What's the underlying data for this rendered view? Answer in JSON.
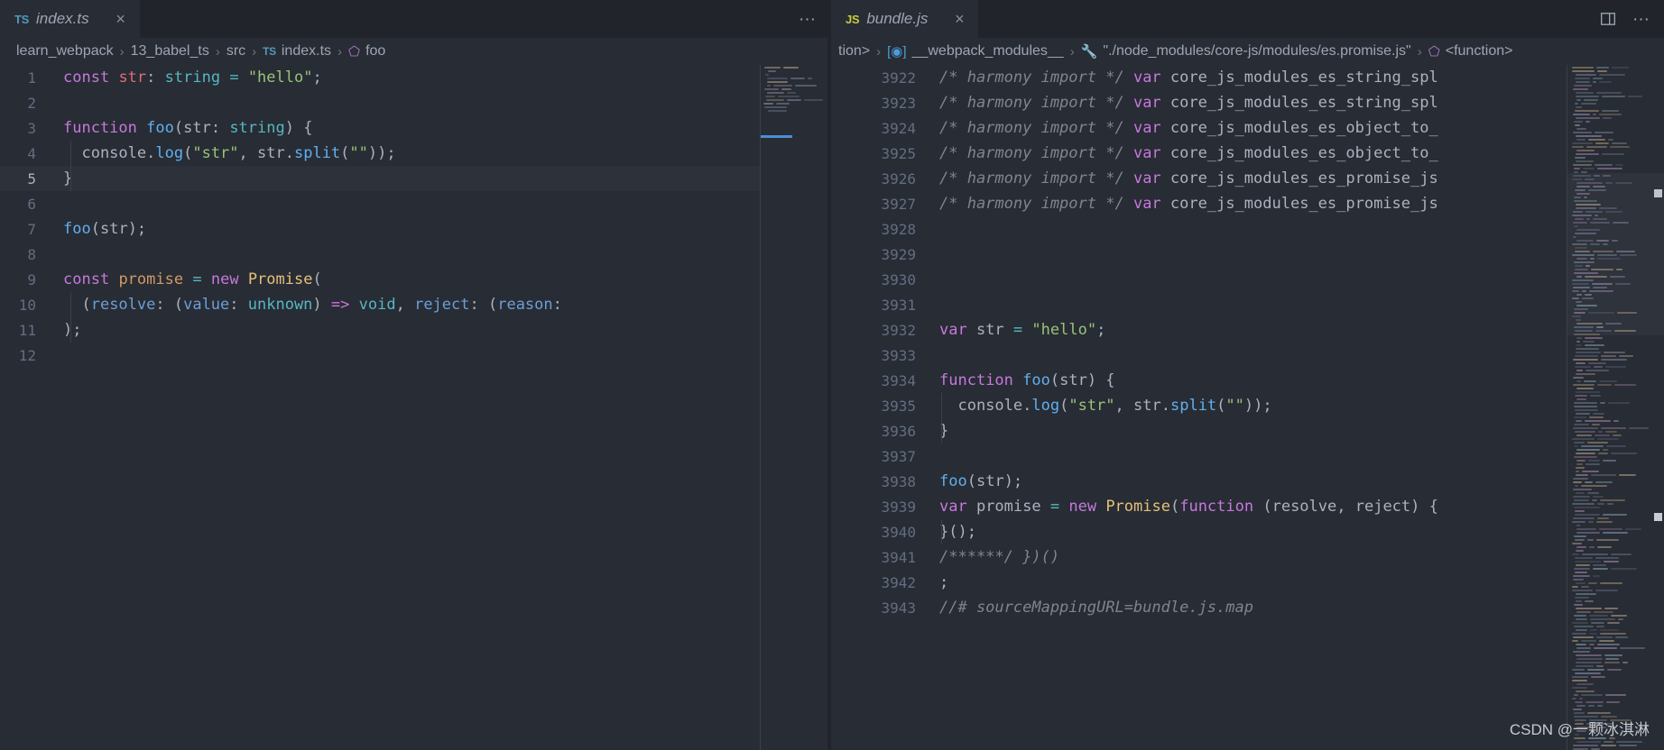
{
  "theme": {
    "editor_bg": "#282c34",
    "tabbar_bg": "#21252b",
    "active_line_bg": "#2c313a",
    "line_number": "#636d83",
    "foreground": "#abb2bf",
    "keyword": "#c678dd",
    "string": "#98c379",
    "function": "#61afef",
    "type": "#56b6c2",
    "variable": "#e06c75",
    "class": "#e5c07b",
    "number_orange": "#d19a66",
    "comment": "#7f848e",
    "accent_blue": "#4b8ed8"
  },
  "left_group": {
    "tab": {
      "icon": "ts-file-icon",
      "icon_label": "TS",
      "label": "index.ts",
      "close_label": "×"
    },
    "actions": [
      {
        "name": "more-actions",
        "glyph": "···"
      }
    ],
    "breadcrumb": [
      {
        "text": "learn_webpack",
        "icon": ""
      },
      {
        "text": "13_babel_ts",
        "icon": ""
      },
      {
        "text": "src",
        "icon": ""
      },
      {
        "text": "index.ts",
        "icon": "TS"
      },
      {
        "text": "foo",
        "icon": "symbol-function-icon"
      }
    ],
    "active_line": 5,
    "lines": [
      {
        "n": 1,
        "tokens": [
          {
            "t": "const",
            "c": "t-kw"
          },
          {
            "t": " ",
            "c": "t-plain"
          },
          {
            "t": "str",
            "c": "t-var"
          },
          {
            "t": ": ",
            "c": "t-punct"
          },
          {
            "t": "string",
            "c": "t-type"
          },
          {
            "t": " ",
            "c": "t-plain"
          },
          {
            "t": "=",
            "c": "t-op"
          },
          {
            "t": " ",
            "c": "t-plain"
          },
          {
            "t": "\"hello\"",
            "c": "t-str"
          },
          {
            "t": ";",
            "c": "t-punct"
          }
        ]
      },
      {
        "n": 2,
        "tokens": []
      },
      {
        "n": 3,
        "tokens": [
          {
            "t": "function",
            "c": "t-kw"
          },
          {
            "t": " ",
            "c": "t-plain"
          },
          {
            "t": "foo",
            "c": "t-fn"
          },
          {
            "t": "(",
            "c": "t-punct"
          },
          {
            "t": "str",
            "c": "t-arg"
          },
          {
            "t": ": ",
            "c": "t-punct"
          },
          {
            "t": "string",
            "c": "t-type"
          },
          {
            "t": ") {",
            "c": "t-punct"
          }
        ]
      },
      {
        "n": 4,
        "tokens": [
          {
            "t": "  console",
            "c": "t-plain"
          },
          {
            "t": ".",
            "c": "t-punct"
          },
          {
            "t": "log",
            "c": "t-fn"
          },
          {
            "t": "(",
            "c": "t-punct"
          },
          {
            "t": "\"str\"",
            "c": "t-str"
          },
          {
            "t": ", ",
            "c": "t-punct"
          },
          {
            "t": "str",
            "c": "t-plain"
          },
          {
            "t": ".",
            "c": "t-punct"
          },
          {
            "t": "split",
            "c": "t-fn"
          },
          {
            "t": "(",
            "c": "t-punct"
          },
          {
            "t": "\"\"",
            "c": "t-str"
          },
          {
            "t": "));",
            "c": "t-punct"
          }
        ]
      },
      {
        "n": 5,
        "tokens": [
          {
            "t": "}",
            "c": "t-punct"
          }
        ]
      },
      {
        "n": 6,
        "tokens": []
      },
      {
        "n": 7,
        "tokens": [
          {
            "t": "foo",
            "c": "t-fn"
          },
          {
            "t": "(",
            "c": "t-punct"
          },
          {
            "t": "str",
            "c": "t-arg"
          },
          {
            "t": ");",
            "c": "t-punct"
          }
        ]
      },
      {
        "n": 8,
        "tokens": []
      },
      {
        "n": 9,
        "tokens": [
          {
            "t": "const",
            "c": "t-kw"
          },
          {
            "t": " ",
            "c": "t-plain"
          },
          {
            "t": "promise",
            "c": "t-param"
          },
          {
            "t": " ",
            "c": "t-plain"
          },
          {
            "t": "=",
            "c": "t-op"
          },
          {
            "t": " ",
            "c": "t-plain"
          },
          {
            "t": "new",
            "c": "t-kw"
          },
          {
            "t": " ",
            "c": "t-plain"
          },
          {
            "t": "Promise",
            "c": "t-class"
          },
          {
            "t": "(",
            "c": "t-punct"
          }
        ]
      },
      {
        "n": 10,
        "tokens": [
          {
            "t": "  (",
            "c": "t-punct"
          },
          {
            "t": "resolve",
            "c": "t-paramblue"
          },
          {
            "t": ": (",
            "c": "t-punct"
          },
          {
            "t": "value",
            "c": "t-paramblue"
          },
          {
            "t": ": ",
            "c": "t-punct"
          },
          {
            "t": "unknown",
            "c": "t-type"
          },
          {
            "t": ") ",
            "c": "t-punct"
          },
          {
            "t": "=>",
            "c": "t-kw"
          },
          {
            "t": " ",
            "c": "t-plain"
          },
          {
            "t": "void",
            "c": "t-type"
          },
          {
            "t": ", ",
            "c": "t-punct"
          },
          {
            "t": "reject",
            "c": "t-paramblue"
          },
          {
            "t": ": (",
            "c": "t-punct"
          },
          {
            "t": "reason",
            "c": "t-paramblue"
          },
          {
            "t": ":",
            "c": "t-punct"
          }
        ]
      },
      {
        "n": 11,
        "tokens": [
          {
            "t": ");",
            "c": "t-punct"
          }
        ]
      },
      {
        "n": 12,
        "tokens": []
      }
    ]
  },
  "right_group": {
    "tab": {
      "icon": "js-file-icon",
      "icon_label": "JS",
      "label": "bundle.js",
      "close_label": "×"
    },
    "actions": [
      {
        "name": "split-editor",
        "glyph": "⬚"
      },
      {
        "name": "more-actions",
        "glyph": "···"
      }
    ],
    "breadcrumb": [
      {
        "text": "tion>",
        "icon": ""
      },
      {
        "text": "__webpack_modules__",
        "icon": "module-icon"
      },
      {
        "text": "\"./node_modules/core-js/modules/es.promise.js\"",
        "icon": "wrench-icon"
      },
      {
        "text": "<function>",
        "icon": "symbol-function-icon"
      }
    ],
    "lines": [
      {
        "n": 3922,
        "tokens": [
          {
            "t": "/* harmony import */",
            "c": "t-comment"
          },
          {
            "t": " ",
            "c": "t-plain"
          },
          {
            "t": "var",
            "c": "t-kw"
          },
          {
            "t": " core_js_modules_es_string_spl",
            "c": "t-plain"
          }
        ]
      },
      {
        "n": 3923,
        "tokens": [
          {
            "t": "/* harmony import */",
            "c": "t-comment"
          },
          {
            "t": " ",
            "c": "t-plain"
          },
          {
            "t": "var",
            "c": "t-kw"
          },
          {
            "t": " core_js_modules_es_string_spl",
            "c": "t-plain"
          }
        ]
      },
      {
        "n": 3924,
        "tokens": [
          {
            "t": "/* harmony import */",
            "c": "t-comment"
          },
          {
            "t": " ",
            "c": "t-plain"
          },
          {
            "t": "var",
            "c": "t-kw"
          },
          {
            "t": " core_js_modules_es_object_to_",
            "c": "t-plain"
          }
        ]
      },
      {
        "n": 3925,
        "tokens": [
          {
            "t": "/* harmony import */",
            "c": "t-comment"
          },
          {
            "t": " ",
            "c": "t-plain"
          },
          {
            "t": "var",
            "c": "t-kw"
          },
          {
            "t": " core_js_modules_es_object_to_",
            "c": "t-plain"
          }
        ]
      },
      {
        "n": 3926,
        "tokens": [
          {
            "t": "/* harmony import */",
            "c": "t-comment"
          },
          {
            "t": " ",
            "c": "t-plain"
          },
          {
            "t": "var",
            "c": "t-kw"
          },
          {
            "t": " core_js_modules_es_promise_js",
            "c": "t-plain"
          }
        ]
      },
      {
        "n": 3927,
        "tokens": [
          {
            "t": "/* harmony import */",
            "c": "t-comment"
          },
          {
            "t": " ",
            "c": "t-plain"
          },
          {
            "t": "var",
            "c": "t-kw"
          },
          {
            "t": " core_js_modules_es_promise_js",
            "c": "t-plain"
          }
        ]
      },
      {
        "n": 3928,
        "tokens": []
      },
      {
        "n": 3929,
        "tokens": []
      },
      {
        "n": 3930,
        "tokens": []
      },
      {
        "n": 3931,
        "tokens": []
      },
      {
        "n": 3932,
        "tokens": [
          {
            "t": "var",
            "c": "t-kw"
          },
          {
            "t": " str ",
            "c": "t-plain"
          },
          {
            "t": "=",
            "c": "t-op"
          },
          {
            "t": " ",
            "c": "t-plain"
          },
          {
            "t": "\"hello\"",
            "c": "t-str"
          },
          {
            "t": ";",
            "c": "t-punct"
          }
        ]
      },
      {
        "n": 3933,
        "tokens": []
      },
      {
        "n": 3934,
        "tokens": [
          {
            "t": "function",
            "c": "t-kw"
          },
          {
            "t": " ",
            "c": "t-plain"
          },
          {
            "t": "foo",
            "c": "t-fn"
          },
          {
            "t": "(",
            "c": "t-punct"
          },
          {
            "t": "str",
            "c": "t-arg"
          },
          {
            "t": ") {",
            "c": "t-punct"
          }
        ]
      },
      {
        "n": 3935,
        "tokens": [
          {
            "t": "  console",
            "c": "t-plain"
          },
          {
            "t": ".",
            "c": "t-punct"
          },
          {
            "t": "log",
            "c": "t-fn"
          },
          {
            "t": "(",
            "c": "t-punct"
          },
          {
            "t": "\"str\"",
            "c": "t-str"
          },
          {
            "t": ", ",
            "c": "t-punct"
          },
          {
            "t": "str",
            "c": "t-plain"
          },
          {
            "t": ".",
            "c": "t-punct"
          },
          {
            "t": "split",
            "c": "t-fn"
          },
          {
            "t": "(",
            "c": "t-punct"
          },
          {
            "t": "\"\"",
            "c": "t-str"
          },
          {
            "t": "));",
            "c": "t-punct"
          }
        ]
      },
      {
        "n": 3936,
        "tokens": [
          {
            "t": "}",
            "c": "t-punct"
          }
        ]
      },
      {
        "n": 3937,
        "tokens": []
      },
      {
        "n": 3938,
        "tokens": [
          {
            "t": "foo",
            "c": "t-fn"
          },
          {
            "t": "(",
            "c": "t-punct"
          },
          {
            "t": "str",
            "c": "t-arg"
          },
          {
            "t": ");",
            "c": "t-punct"
          }
        ]
      },
      {
        "n": 3939,
        "tokens": [
          {
            "t": "var",
            "c": "t-kw"
          },
          {
            "t": " promise ",
            "c": "t-plain"
          },
          {
            "t": "=",
            "c": "t-op"
          },
          {
            "t": " ",
            "c": "t-plain"
          },
          {
            "t": "new",
            "c": "t-kw"
          },
          {
            "t": " ",
            "c": "t-plain"
          },
          {
            "t": "Promise",
            "c": "t-class"
          },
          {
            "t": "(",
            "c": "t-punct"
          },
          {
            "t": "function",
            "c": "t-kw"
          },
          {
            "t": " (",
            "c": "t-punct"
          },
          {
            "t": "resolve",
            "c": "t-arg"
          },
          {
            "t": ", ",
            "c": "t-punct"
          },
          {
            "t": "reject",
            "c": "t-arg"
          },
          {
            "t": ") {",
            "c": "t-punct"
          }
        ]
      },
      {
        "n": 3940,
        "tokens": [
          {
            "t": "}();",
            "c": "t-punct"
          }
        ]
      },
      {
        "n": 3941,
        "tokens": [
          {
            "t": "/******/ })()",
            "c": "t-comment"
          }
        ]
      },
      {
        "n": 3942,
        "tokens": [
          {
            "t": ";",
            "c": "t-punct"
          }
        ]
      },
      {
        "n": 3943,
        "tokens": [
          {
            "t": "//# sourceMappingURL=bundle.js.map",
            "c": "t-comment"
          }
        ]
      }
    ]
  },
  "watermark": {
    "text": "CSDN @一颗冰淇淋"
  }
}
